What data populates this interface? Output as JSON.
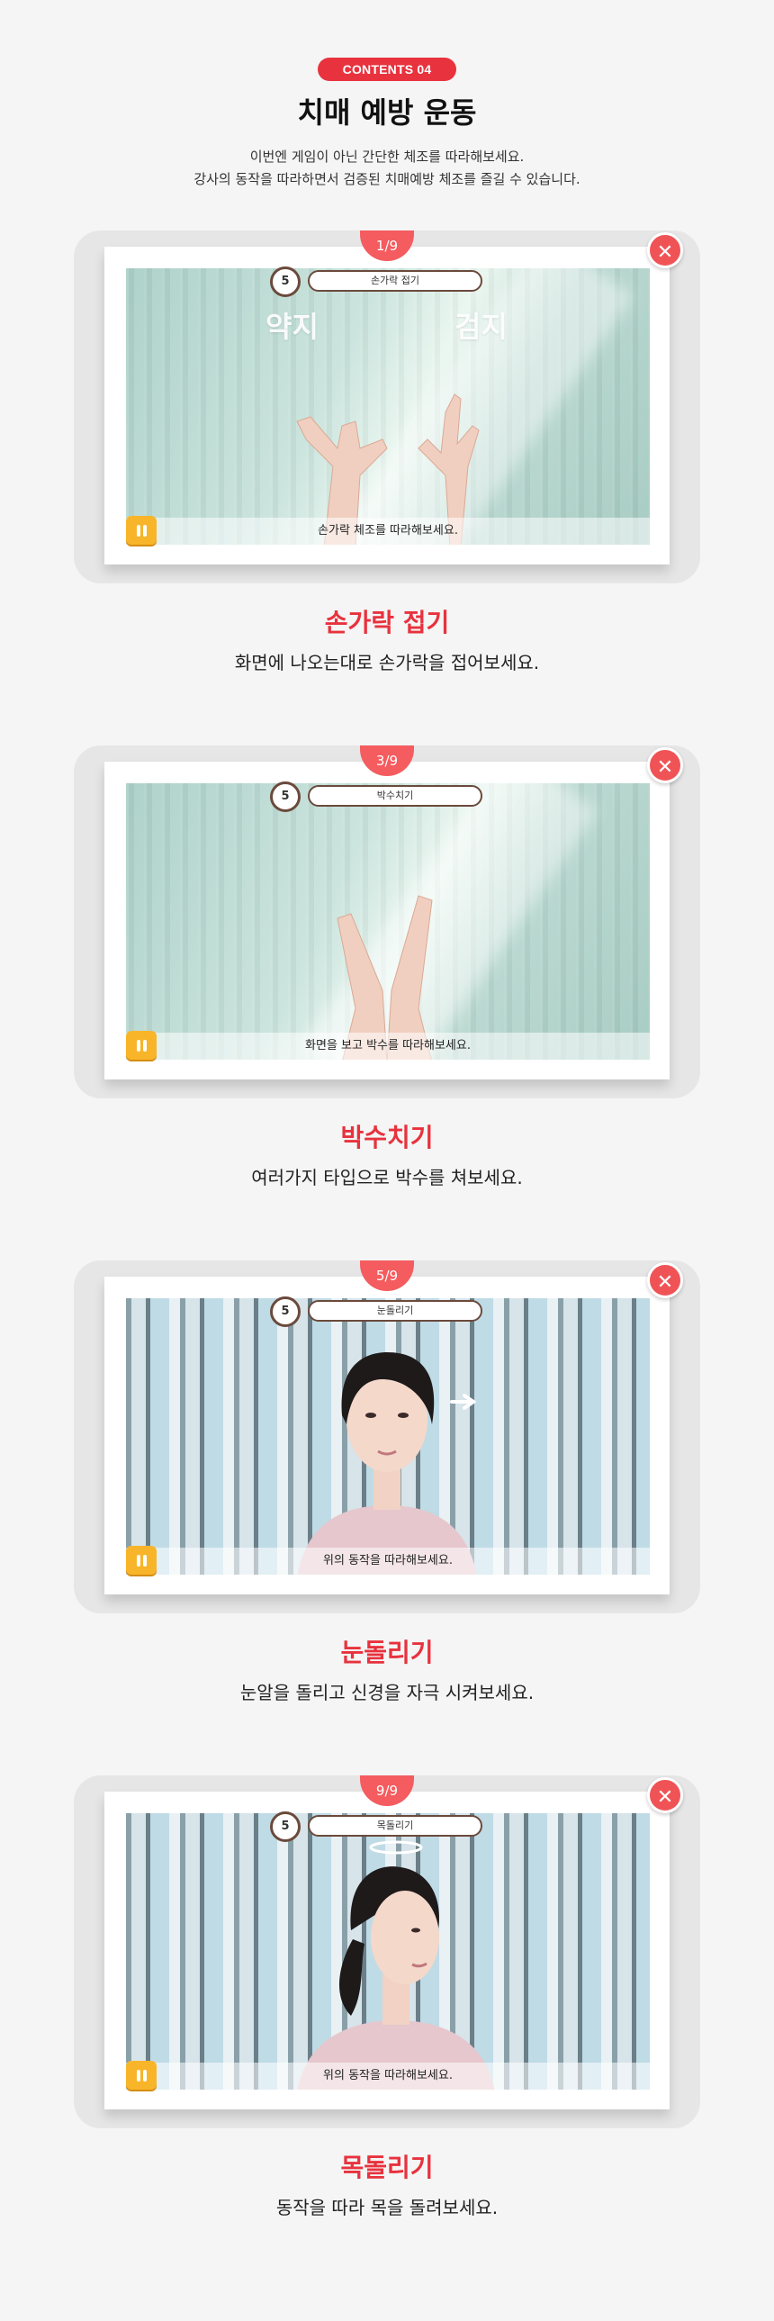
{
  "header": {
    "badge": "CONTENTS 04",
    "title": "치매 예방 운동",
    "intro_line1": "이번엔 게임이 아닌 간단한 체조를 따라해보세요.",
    "intro_line2": "강사의 동작을 따라하면서 검증된 치매예방 체조를 즐길 수 있습니다."
  },
  "cards": [
    {
      "progress": "1/9",
      "timer": "5",
      "exercise": "손가락 접기",
      "caption": "손가락 체조를 따라해보세요.",
      "overlay_left": "약지",
      "overlay_right": "검지",
      "title": "손가락 접기",
      "desc": "화면에 나오는대로 손가락을 접어보세요."
    },
    {
      "progress": "3/9",
      "timer": "5",
      "exercise": "박수치기",
      "caption": "화면을 보고 박수를 따라해보세요.",
      "title": "박수치기",
      "desc": "여러가지 타입으로 박수를 쳐보세요."
    },
    {
      "progress": "5/9",
      "timer": "5",
      "exercise": "눈돌리기",
      "caption": "위의 동작을 따라해보세요.",
      "title": "눈돌리기",
      "desc": "눈알을 돌리고 신경을 자극 시켜보세요."
    },
    {
      "progress": "9/9",
      "timer": "5",
      "exercise": "목돌리기",
      "caption": "위의 동작을 따라해보세요.",
      "title": "목돌리기",
      "desc": "동작을 따라 목을 돌려보세요."
    }
  ],
  "icons": {
    "close": "close-icon",
    "pause": "pause-icon",
    "timer": "stopwatch-icon"
  },
  "colors": {
    "accent": "#e8323e",
    "progress": "#f45c5f",
    "pause": "#f8b52a"
  }
}
